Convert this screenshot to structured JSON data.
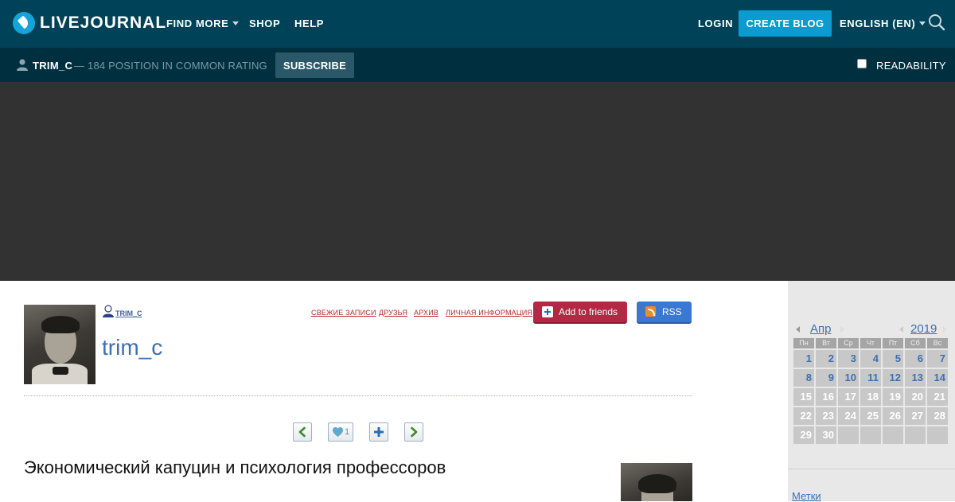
{
  "topnav": {
    "logo_text": "LIVEJOURNAL",
    "find_more": "FIND MORE",
    "shop": "SHOP",
    "help": "HELP",
    "login": "LOGIN",
    "create_blog": "CREATE BLOG",
    "language": "ENGLISH (EN)"
  },
  "subbar": {
    "username": "TRIM_C",
    "rating": "— 184 POSITION IN COMMON RATING",
    "subscribe": "SUBSCRIBE",
    "readability": "READABILITY",
    "readability_checked": false
  },
  "journal": {
    "username_small": "TRIM_C",
    "title": "trim_c",
    "links": [
      "СВЕЖИЕ ЗАПИСИ",
      "ДРУЗЬЯ",
      "АРХИВ",
      "ЛИЧНАЯ ИНФОРМАЦИЯ"
    ],
    "add_to_friends": "Add to friends",
    "rss": "RSS"
  },
  "post": {
    "like_count": "1",
    "title": "Экономический капуцин и психология профессоров"
  },
  "calendar": {
    "month": "Апр",
    "year": "2019",
    "weekdays": [
      "Пн",
      "Вт",
      "Ср",
      "Чт",
      "Пт",
      "Сб",
      "Вс"
    ],
    "weeks": [
      [
        "1",
        "2",
        "3",
        "4",
        "5",
        "6",
        "7"
      ],
      [
        "8",
        "9",
        "10",
        "11",
        "12",
        "13",
        "14"
      ],
      [
        "15",
        "16",
        "17",
        "18",
        "19",
        "20",
        "21"
      ],
      [
        "22",
        "23",
        "24",
        "25",
        "26",
        "27",
        "28"
      ],
      [
        "29",
        "30",
        "",
        "",
        "",
        "",
        ""
      ]
    ],
    "linked_days": [
      "1",
      "2",
      "3",
      "4",
      "5",
      "6",
      "7",
      "8",
      "9",
      "10",
      "11",
      "12",
      "13",
      "14"
    ]
  },
  "sidebar": {
    "tags": "Метки"
  },
  "colors": {
    "topnav_bg": "#004359",
    "subbar_bg": "#00303f",
    "accent_blue": "#0b9bd0",
    "friends_red": "#b32844",
    "link_blue": "#3d6fb3"
  }
}
